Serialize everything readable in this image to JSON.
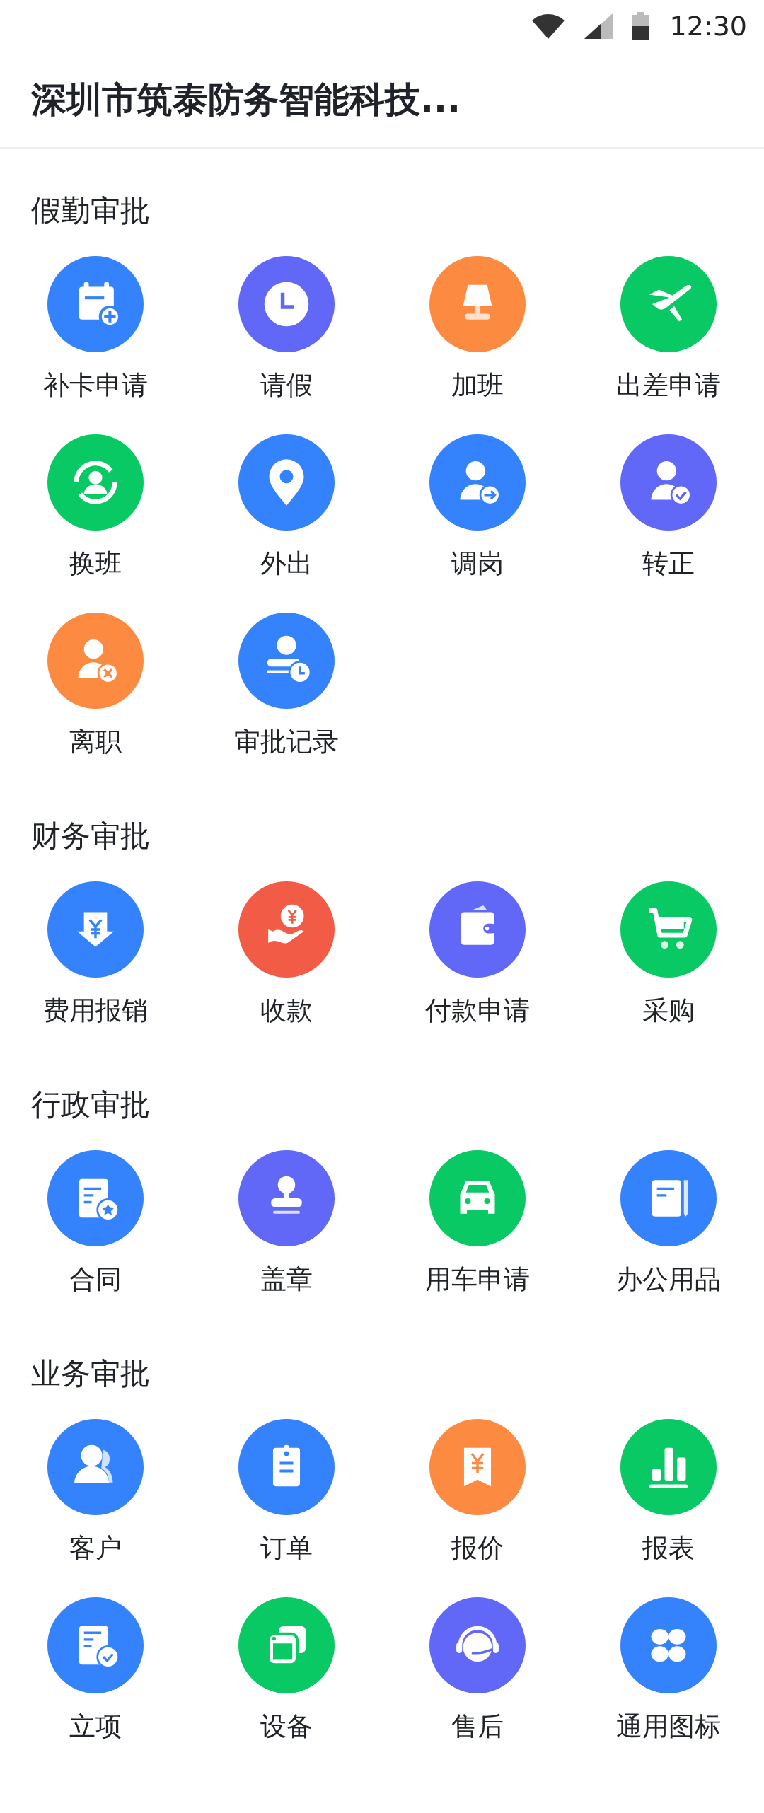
{
  "status_bar": {
    "time": "12:30"
  },
  "header": {
    "title": "深圳市筑泰防务智能科技..."
  },
  "sections": [
    {
      "title": "假勤审批",
      "items": [
        {
          "label": "补卡申请",
          "color": "#3482fc"
        },
        {
          "label": "请假",
          "color": "#6167f7"
        },
        {
          "label": "加班",
          "color": "#fc8a41"
        },
        {
          "label": "出差申请",
          "color": "#08c964"
        },
        {
          "label": "换班",
          "color": "#08c964"
        },
        {
          "label": "外出",
          "color": "#3482fc"
        },
        {
          "label": "调岗",
          "color": "#3482fc"
        },
        {
          "label": "转正",
          "color": "#6167f7"
        },
        {
          "label": "离职",
          "color": "#fc8a41"
        },
        {
          "label": "审批记录",
          "color": "#3482fc"
        }
      ]
    },
    {
      "title": "财务审批",
      "items": [
        {
          "label": "费用报销",
          "color": "#3482fc"
        },
        {
          "label": "收款",
          "color": "#f25b45"
        },
        {
          "label": "付款申请",
          "color": "#6167f7"
        },
        {
          "label": "采购",
          "color": "#08c964"
        }
      ]
    },
    {
      "title": "行政审批",
      "items": [
        {
          "label": "合同",
          "color": "#3482fc"
        },
        {
          "label": "盖章",
          "color": "#6167f7"
        },
        {
          "label": "用车申请",
          "color": "#08c964"
        },
        {
          "label": "办公用品",
          "color": "#3482fc"
        }
      ]
    },
    {
      "title": "业务审批",
      "items": [
        {
          "label": "客户",
          "color": "#3482fc"
        },
        {
          "label": "订单",
          "color": "#3482fc"
        },
        {
          "label": "报价",
          "color": "#fc8a41"
        },
        {
          "label": "报表",
          "color": "#08c964"
        },
        {
          "label": "立项",
          "color": "#3482fc"
        },
        {
          "label": "设备",
          "color": "#08c964"
        },
        {
          "label": "售后",
          "color": "#6167f7"
        },
        {
          "label": "通用图标",
          "color": "#3482fc"
        }
      ]
    }
  ]
}
